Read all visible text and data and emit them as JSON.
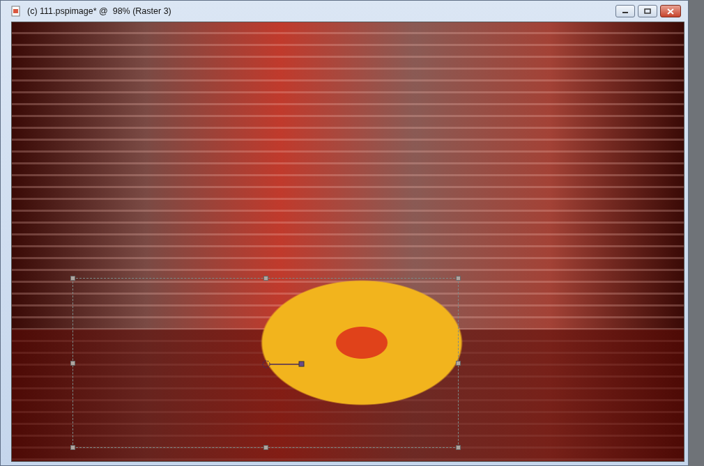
{
  "window": {
    "title": "(c) 111.pspimage* @  98% (Raster 3)"
  }
}
